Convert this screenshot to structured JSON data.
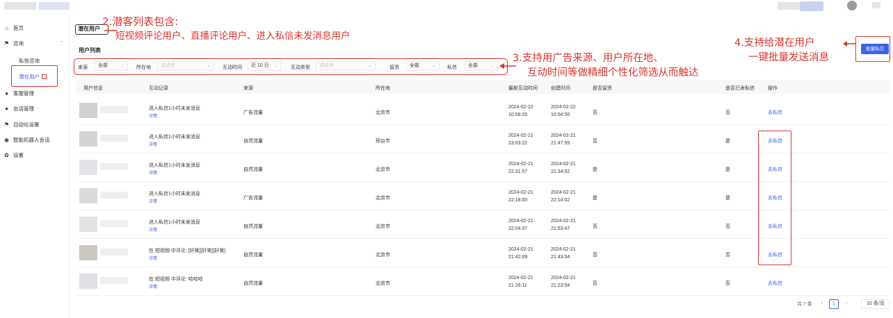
{
  "annotations": {
    "a2_line1": "2.潜客列表包含:",
    "a2_line2": "短视频评论用户、直播评论用户、进入私信未发消息用户",
    "a3_line1": "3.支持用广告来源、用户所在地、",
    "a3_line2": "互动时间等做精细个性化筛选从而触达",
    "a4_line1": "4.支持给潜在用户",
    "a4_line2": "一键批量发送消息"
  },
  "sidebar": {
    "items": [
      {
        "label": "首页",
        "icon": "home-icon"
      },
      {
        "label": "咨询",
        "icon": "flag-icon"
      },
      {
        "label": "私信咨询"
      },
      {
        "label": "潜在用户"
      },
      {
        "label": "客服管理",
        "icon": "user-icon"
      },
      {
        "label": "会话管理",
        "icon": "users-icon"
      },
      {
        "label": "自动化设置",
        "icon": "flag2-icon"
      },
      {
        "label": "智能机器人会话",
        "icon": "robot-icon"
      },
      {
        "label": "设置",
        "icon": "gear-icon"
      }
    ]
  },
  "page": {
    "title": "潜在用户",
    "list_title": "用户列表",
    "batch_button": "批量私信"
  },
  "filters": {
    "source": {
      "label": "来源",
      "value": "全部"
    },
    "location": {
      "label": "所在地",
      "placeholder": "请选择"
    },
    "time": {
      "label": "互动时间",
      "value": "近 10 日"
    },
    "type": {
      "label": "互动类型",
      "placeholder": "请选择"
    },
    "leads": {
      "label": "留资",
      "value": "全部"
    },
    "dm": {
      "label": "私信",
      "value": "全部"
    }
  },
  "table": {
    "headers": [
      "用户信息",
      "互动记录",
      "来源",
      "所在地",
      "最新互动时间",
      "创建时间",
      "是否留资",
      "是否已发私信",
      "操作"
    ],
    "detail_label": "详情",
    "rows": [
      {
        "record": "进入私信1小时未发消息",
        "source": "广告流量",
        "location": "北京市",
        "latest_date": "2024-02-22",
        "latest_time": "10:59:20",
        "created_date": "2024-02-22",
        "created_time": "10:54:50",
        "leads": "否",
        "dm_sent": "否",
        "action": "去私信"
      },
      {
        "record": "进入私信1小时未发消息",
        "source": "自然流量",
        "location": "邢台市",
        "latest_date": "2024-02-21",
        "latest_time": "23:03:22",
        "created_date": "2024-02-21",
        "created_time": "21:47:55",
        "leads": "否",
        "dm_sent": "是",
        "action": "去私信"
      },
      {
        "record": "进入私信1小时未发消息",
        "source": "自然流量",
        "location": "北京市",
        "latest_date": "2024-02-21",
        "latest_time": "22:31:57",
        "created_date": "2024-02-21",
        "created_time": "21:34:52",
        "leads": "是",
        "dm_sent": "是",
        "action": "去私信"
      },
      {
        "record": "进入私信1小时未发消息",
        "source": "广告流量",
        "location": "北京市",
        "latest_date": "2024-02-21",
        "latest_time": "22:18:00",
        "created_date": "2024-02-21",
        "created_time": "22:14:02",
        "leads": "是",
        "dm_sent": "是",
        "action": "去私信"
      },
      {
        "record": "进入私信1小时未发消息",
        "source": "自然流量",
        "location": "北京市",
        "latest_date": "2024-02-21",
        "latest_time": "22:04:37",
        "created_date": "2024-02-21",
        "created_time": "21:53:47",
        "leads": "否",
        "dm_sent": "否",
        "action": "去私信"
      },
      {
        "record": "在 短视频 中评论: [奸笑][奸笑][奸笑]",
        "source": "自然流量",
        "location": "北京市",
        "latest_date": "2024-02-21",
        "latest_time": "21:42:09",
        "created_date": "2024-02-21",
        "created_time": "21:43:04",
        "leads": "否",
        "dm_sent": "否",
        "action": "去私信"
      },
      {
        "record": "在 短视频 中评论: 哈哈哈",
        "source": "自然流量",
        "location": "北京市",
        "latest_date": "2024-02-21",
        "latest_time": "21:26:11",
        "created_date": "2024-02-21",
        "created_time": "21:23:54",
        "leads": "否",
        "dm_sent": "否",
        "action": "去私信"
      }
    ]
  },
  "pagination": {
    "total": "共 7 条",
    "prev": "‹",
    "page": "1",
    "next": "›",
    "page_size": "10 条/页"
  },
  "colors": {
    "accent": "#3b63e6",
    "annotation": "#d8342c"
  }
}
